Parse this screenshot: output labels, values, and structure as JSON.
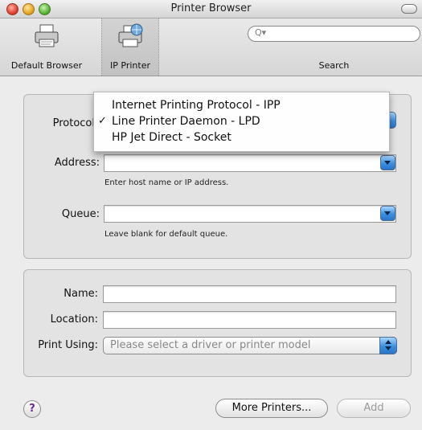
{
  "window": {
    "title": "Printer Browser"
  },
  "toolbar": {
    "default_browser_label": "Default Browser",
    "ip_printer_label": "IP Printer",
    "search_label": "Search",
    "search_icon": "search-icon"
  },
  "protocol": {
    "label": "Protocol",
    "menu_items": [
      {
        "label": "Internet Printing Protocol - IPP",
        "checked": false
      },
      {
        "label": "Line Printer Daemon - LPD",
        "checked": true
      },
      {
        "label": "HP Jet Direct - Socket",
        "checked": false
      }
    ],
    "check_mark": "✓"
  },
  "address": {
    "label": "Address:",
    "value": "",
    "hint": "Enter host name or IP address."
  },
  "queue": {
    "label": "Queue:",
    "value": "",
    "hint": "Leave blank for default queue."
  },
  "name": {
    "label": "Name:",
    "value": ""
  },
  "location": {
    "label": "Location:",
    "value": ""
  },
  "print_using": {
    "label": "Print Using:",
    "value": "Please select a driver or printer model"
  },
  "footer": {
    "help_label": "?",
    "more_printers_label": "More Printers...",
    "add_label": "Add"
  },
  "colors": {
    "accent_blue": "#3a8fe0",
    "window_bg": "#ececec"
  }
}
